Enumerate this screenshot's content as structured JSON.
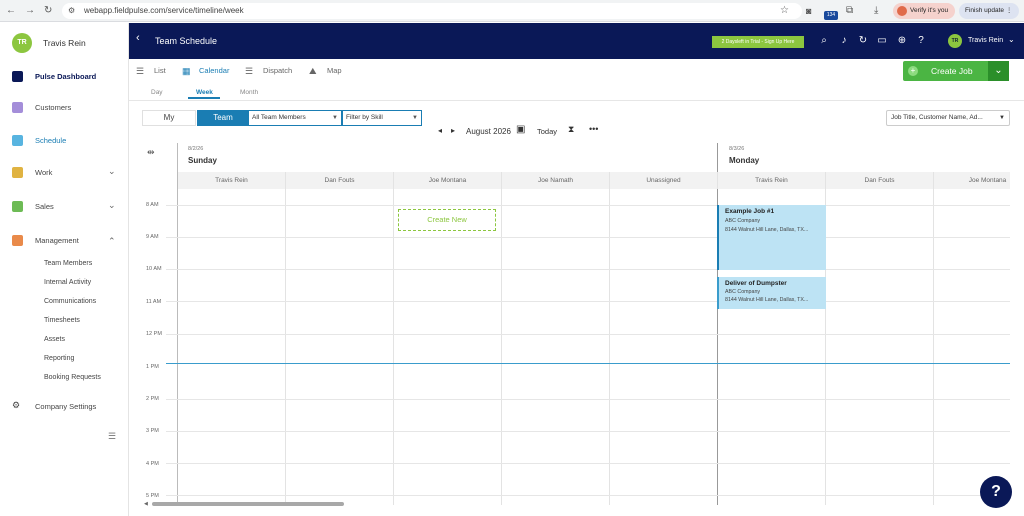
{
  "browser": {
    "url": "webapp.fieldpulse.com/service/timeline/week",
    "verify": "Verify it's you",
    "finish": "Finish update",
    "ext_badge": "134"
  },
  "sidebar": {
    "avatar": "TR",
    "user": "Travis Rein",
    "items": [
      {
        "label": "Pulse Dashboard"
      },
      {
        "label": "Customers"
      },
      {
        "label": "Schedule"
      },
      {
        "label": "Work"
      },
      {
        "label": "Sales"
      },
      {
        "label": "Management"
      }
    ],
    "subitems": [
      "Team Members",
      "Internal Activity",
      "Communications",
      "Timesheets",
      "Assets",
      "Reporting",
      "Booking Requests"
    ],
    "settings": "Company Settings",
    "colors": {
      "active": "#1a7db3"
    }
  },
  "header": {
    "title": "Team Schedule",
    "trial": "2 Daysleft in Trial - Sign Up Here",
    "avatar": "TR",
    "user": "Travis Rein",
    "bg": "#0a1857"
  },
  "views": {
    "list": "List",
    "calendar": "Calendar",
    "dispatch": "Dispatch",
    "map": "Map"
  },
  "periods": {
    "day": "Day",
    "week": "Week",
    "month": "Month"
  },
  "create_job": "Create Job",
  "controls": {
    "my": "My",
    "team": "Team",
    "members": "All Team Members",
    "skill": "Filter by Skill",
    "month": "August 2026",
    "today": "Today",
    "search": "Job Title, Customer Name, Ad..."
  },
  "days": [
    {
      "date": "8/2/26",
      "name": "Sunday",
      "columns": [
        "Travis Rein",
        "Dan Fouts",
        "Joe Montana",
        "Joe Namath",
        "Unassigned"
      ]
    },
    {
      "date": "8/3/26",
      "name": "Monday",
      "columns": [
        "Travis Rein",
        "Dan Fouts",
        "Joe Montana"
      ]
    }
  ],
  "times": [
    "8 AM",
    "9 AM",
    "10 AM",
    "11 AM",
    "12 PM",
    "1 PM",
    "2 PM",
    "3 PM",
    "4 PM",
    "5 PM"
  ],
  "create_new": "Create New",
  "jobs": [
    {
      "title": "Example Job #1",
      "company": "ABC Company",
      "address": "8144 Walnut Hill Lane, Dallas, TX..."
    },
    {
      "title": "Deliver of Dumpster",
      "company": "ABC Company",
      "address": "8144 Walnut Hill Lane, Dallas, TX..."
    }
  ]
}
